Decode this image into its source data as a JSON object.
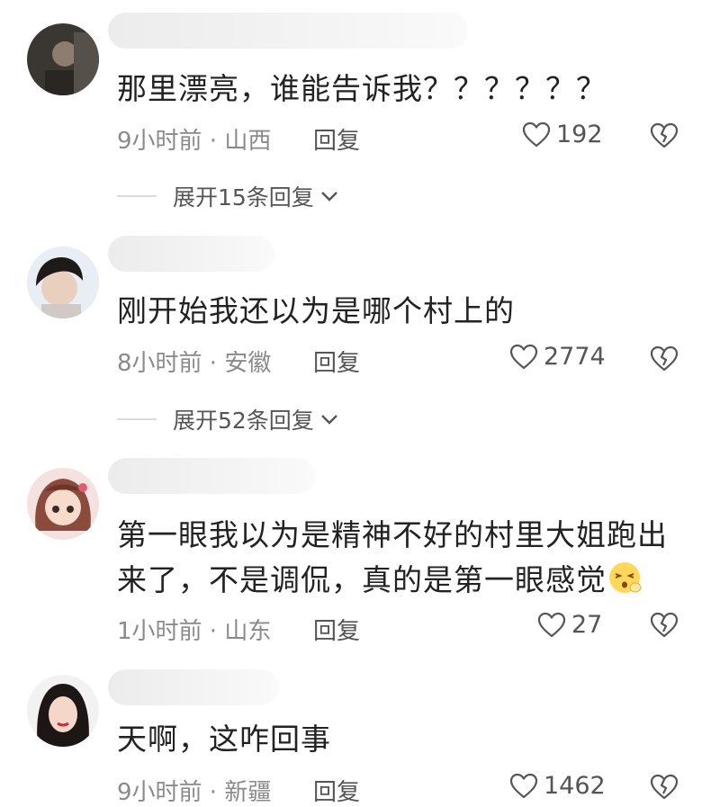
{
  "comments": [
    {
      "text": "那里漂亮，谁能告诉我？？？？？？",
      "meta": "9小时前 · 山西",
      "reply_label": "回复",
      "likes": "192",
      "expand_label": "展开15条回复"
    },
    {
      "text": "刚开始我还以为是哪个村上的",
      "meta": "8小时前 · 安徽",
      "reply_label": "回复",
      "likes": "2774",
      "expand_label": "展开52条回复"
    },
    {
      "text_line1": "第一眼我以为是精神不好的村里大姐跑出",
      "text_line2": "来了，不是调侃，真的是第一眼感觉",
      "meta": "1小时前 · 山东",
      "reply_label": "回复",
      "likes": "27"
    },
    {
      "text": "天啊，这咋回事",
      "meta": "9小时前 · 新疆",
      "reply_label": "回复",
      "likes": "1462"
    }
  ],
  "icons": {
    "like": "heart-outline-icon",
    "dislike": "broken-heart-icon",
    "expand": "chevron-down-icon",
    "emoji": "squint-face-emoji"
  },
  "colors": {
    "text": "#222222",
    "meta": "#8a8a8a",
    "icon": "#555555"
  }
}
